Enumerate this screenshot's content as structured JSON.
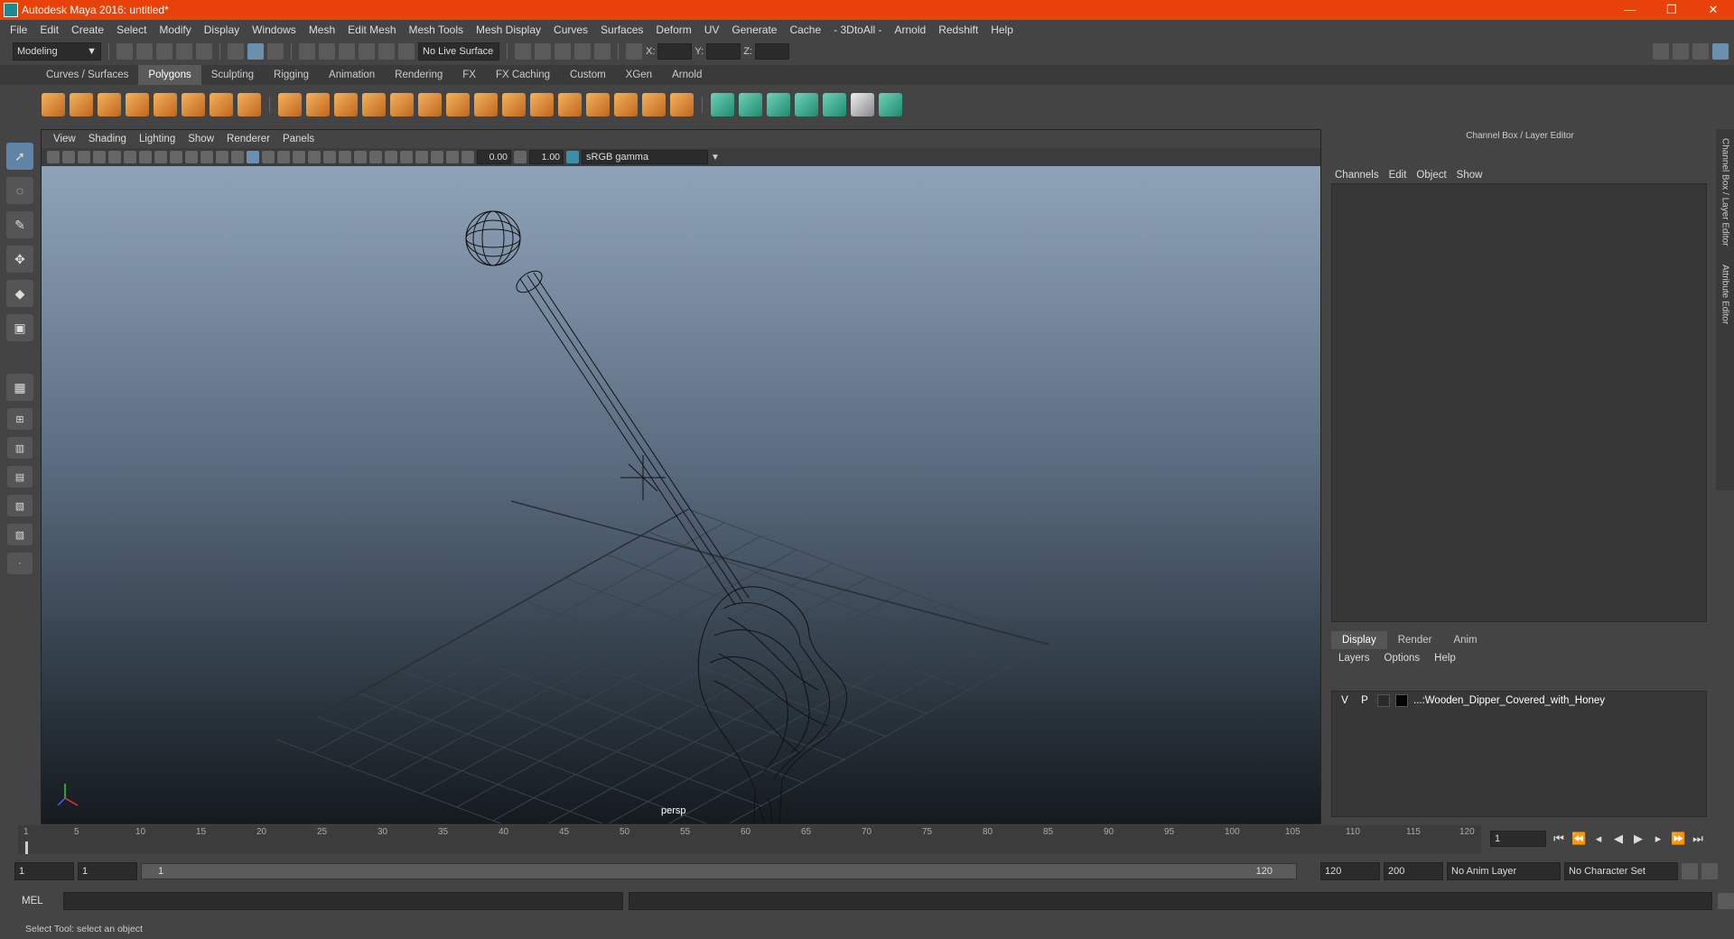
{
  "app": {
    "title": "Autodesk Maya 2016: untitled*"
  },
  "window_controls": {
    "minimize": "—",
    "restore": "❐",
    "close": "✕"
  },
  "menubar": [
    "File",
    "Edit",
    "Create",
    "Select",
    "Modify",
    "Display",
    "Windows",
    "Mesh",
    "Edit Mesh",
    "Mesh Tools",
    "Mesh Display",
    "Curves",
    "Surfaces",
    "Deform",
    "UV",
    "Generate",
    "Cache",
    "- 3DtoAll -",
    "Arnold",
    "Redshift",
    "Help"
  ],
  "toolbar": {
    "mode": "Modeling",
    "live_surface": "No Live Surface",
    "x_label": "X:",
    "y_label": "Y:",
    "z_label": "Z:"
  },
  "shelf_tabs": [
    "Curves / Surfaces",
    "Polygons",
    "Sculpting",
    "Rigging",
    "Animation",
    "Rendering",
    "FX",
    "FX Caching",
    "Custom",
    "XGen",
    "Arnold"
  ],
  "shelf_active": "Polygons",
  "viewport": {
    "menu": [
      "View",
      "Shading",
      "Lighting",
      "Show",
      "Renderer",
      "Panels"
    ],
    "exposure": "0.00",
    "gamma_value": "1.00",
    "color_space": "sRGB gamma",
    "camera": "persp"
  },
  "right_panel": {
    "title": "Channel Box / Layer Editor",
    "menu": [
      "Channels",
      "Edit",
      "Object",
      "Show"
    ],
    "layer_tabs": [
      "Display",
      "Render",
      "Anim"
    ],
    "layer_tab_active": "Display",
    "layer_menu": [
      "Layers",
      "Options",
      "Help"
    ],
    "layers": [
      {
        "v": "V",
        "p": "P",
        "name": "...:Wooden_Dipper_Covered_with_Honey"
      }
    ],
    "side_tabs": [
      "Channel Box / Layer Editor",
      "Attribute Editor"
    ]
  },
  "timeline": {
    "ticks": [
      "1",
      "5",
      "10",
      "15",
      "20",
      "25",
      "30",
      "35",
      "40",
      "45",
      "50",
      "55",
      "60",
      "65",
      "70",
      "75",
      "80",
      "85",
      "90",
      "95",
      "100",
      "105",
      "110",
      "115",
      "120"
    ],
    "current_frame": "1"
  },
  "range": {
    "start": "1",
    "playback_start": "1",
    "slider_start": "1",
    "slider_end": "120",
    "playback_end": "120",
    "end": "200",
    "anim_layer": "No Anim Layer",
    "character_set": "No Character Set"
  },
  "command": {
    "label": "MEL"
  },
  "help_line": "Select Tool: select an object",
  "colors": {
    "titlebar": "#e8410a",
    "accent": "#5f84a6"
  }
}
